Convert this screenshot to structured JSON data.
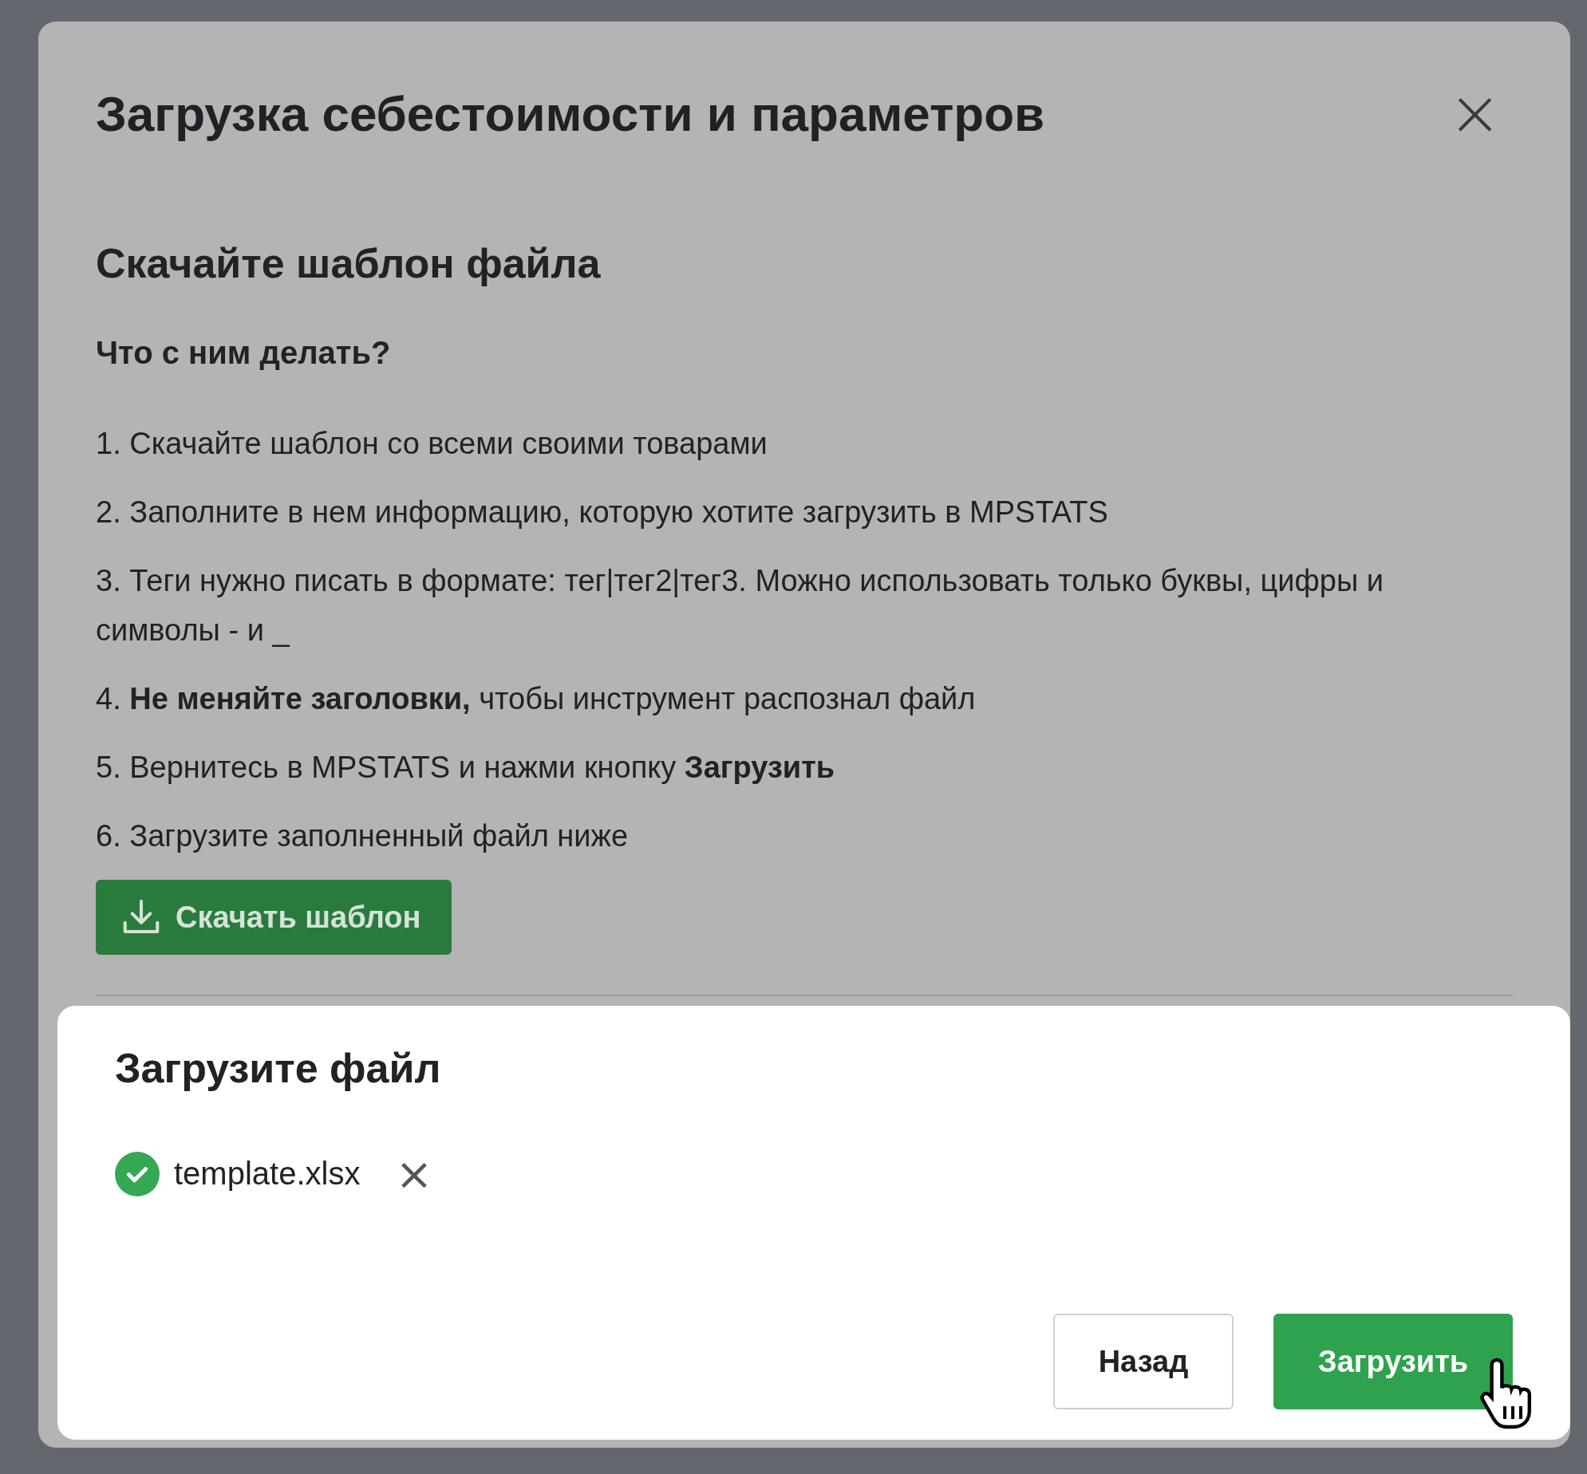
{
  "dialog": {
    "title": "Загрузка себестоимости и параметров",
    "close": "×",
    "step_1": {
      "heading": "Скачайте шаблон файла",
      "subheading": "Что с ним делать?",
      "instructions": [
        "1. Скачайте шаблон со всеми своими товарами",
        "2. Заполните в нем информацию, которую хотите загрузить в MPSTATS",
        "3. Теги нужно писать в формате: тег|тег2|тег3. Можно использовать только буквы, цифры и символы - и _",
        "4. **Не меняйте заголовки,** чтобы инструмент распознал файл",
        "5. Вернитесь в MPSTATS и нажми кнопку **Загрузить**",
        "6. Загрузите заполненный файл ниже"
      ],
      "button": "Скачать шаблон"
    },
    "step_2": {
      "heading": "Загрузите файл",
      "file": {
        "name": "template.xlsx",
        "uploaded": true,
        "remove": "×"
      },
      "buttons": [
        {
          "label": "Назад",
          "kind": "secondary"
        },
        {
          "label": "Загрузить",
          "kind": "primary"
        }
      ]
    }
  }
}
